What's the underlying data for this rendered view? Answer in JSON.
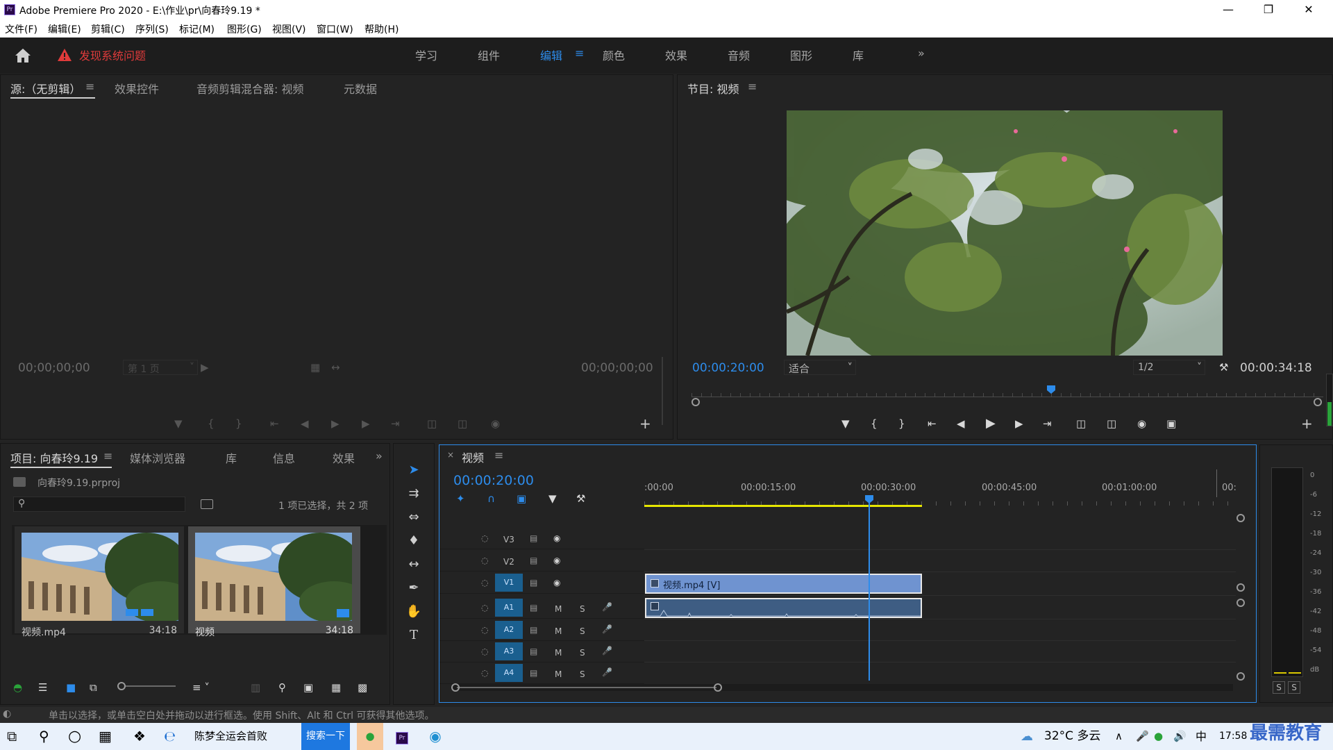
{
  "window": {
    "app_title": "Adobe Premiere Pro 2020 - E:\\作业\\pr\\向春玲9.19 *",
    "icon_label": "Pr"
  },
  "menu": [
    "文件(F)",
    "编辑(E)",
    "剪辑(C)",
    "序列(S)",
    "标记(M)",
    "图形(G)",
    "视图(V)",
    "窗口(W)",
    "帮助(H)"
  ],
  "workspace": {
    "warning": "发现系统问题",
    "tabs": [
      "学习",
      "组件",
      "编辑",
      "颜色",
      "效果",
      "音频",
      "图形",
      "库"
    ],
    "active": "编辑",
    "overflow": "»"
  },
  "source_panel": {
    "tabs": [
      "源:（无剪辑）",
      "效果控件",
      "音频剪辑混合器: 视频",
      "元数据"
    ],
    "tc_in": "00;00;00;00",
    "tc_out": "00;00;00;00",
    "page_select": "第 1 页"
  },
  "program_panel": {
    "title": "节目: 视频",
    "tc_current": "00:00:20:00",
    "fit_select": "适合",
    "res_select": "1/2",
    "tc_duration": "00:00:34:18"
  },
  "project_panel": {
    "tabs": [
      "项目: 向春玲9.19",
      "媒体浏览器",
      "库",
      "信息",
      "效果"
    ],
    "file": "向春玲9.19.prproj",
    "search_placeholder": "",
    "selection_info": "1 项已选择，共 2 项",
    "items": [
      {
        "name": "视频.mp4",
        "duration": "34:18"
      },
      {
        "name": "视频",
        "duration": "34:18"
      }
    ]
  },
  "timeline": {
    "tab": "视频",
    "tc": "00:00:20:00",
    "ruler": [
      ":00:00",
      "00:00:15:00",
      "00:00:30:00",
      "00:00:45:00",
      "00:01:00:00",
      "00:"
    ],
    "video_tracks": [
      "V3",
      "V2",
      "V1"
    ],
    "audio_tracks": [
      "A1",
      "A2",
      "A3",
      "A4"
    ],
    "track_buttons": {
      "mute": "M",
      "solo": "S"
    },
    "clip_label": "视频.mp4 [V]",
    "playhead_fraction": 0.575
  },
  "audio_meter": {
    "scale": [
      "0",
      "-6",
      "-12",
      "-18",
      "-24",
      "-30",
      "-36",
      "-42",
      "-48",
      "-54",
      "dB"
    ],
    "solo": [
      "S",
      "S"
    ]
  },
  "status": "单击以选择，或单击空白处并拖动以进行框选。使用 Shift、Alt 和 Ctrl 可获得其他选项。",
  "taskbar": {
    "search_text": "陈梦全运会首败",
    "search_button": "搜索一下",
    "weather": "32°C 多云",
    "ime": "中",
    "time": "17:58",
    "watermark": "最需教育"
  },
  "colors": {
    "accent": "#2d8ceb",
    "warning": "#e03b3b",
    "clip_video": "#6f93d0",
    "clip_audio": "#3e5d83",
    "work_area": "#e6e600"
  }
}
